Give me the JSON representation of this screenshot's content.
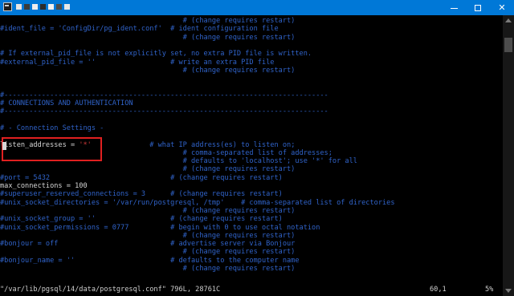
{
  "window": {
    "title_redacted_blocks": [
      "#e6e6e6",
      "#3b3b3b",
      "#ededed",
      "#2c2c2c",
      "#f0f0f0",
      "#4a4a4a",
      "#e8e8e8"
    ],
    "controls": {
      "minimize": "",
      "maximize": "",
      "close": "✕"
    }
  },
  "lines": [
    {
      "text": "                                            # (change requires restart)",
      "color": "blue"
    },
    {
      "text": "#ident_file = 'ConfigDir/pg_ident.conf'  # ident configuration file",
      "color": "blue"
    },
    {
      "text": "                                            # (change requires restart)",
      "color": "blue"
    },
    {
      "text": "",
      "color": "blue"
    },
    {
      "text": "# If external_pid_file is not explicitly set, no extra PID file is written.",
      "color": "blue"
    },
    {
      "text": "#external_pid_file = ''                  # write an extra PID file",
      "color": "blue"
    },
    {
      "text": "                                            # (change requires restart)",
      "color": "blue"
    },
    {
      "text": "",
      "color": "blue"
    },
    {
      "text": "",
      "color": "blue"
    },
    {
      "text": "#------------------------------------------------------------------------------",
      "color": "blue"
    },
    {
      "text": "# CONNECTIONS AND AUTHENTICATION",
      "color": "blue"
    },
    {
      "text": "#------------------------------------------------------------------------------",
      "color": "blue"
    },
    {
      "text": "",
      "color": "blue"
    },
    {
      "text": "# - Connection Settings -",
      "color": "blue"
    },
    {
      "text": "",
      "color": "blue"
    },
    {
      "text": "listen_addresses = '*'",
      "color": "white",
      "value_part": "'*'"
    },
    {
      "text": "                                            # comma-separated list of addresses;",
      "color": "blue"
    },
    {
      "text": "                                            # defaults to 'localhost'; use '*' for all",
      "color": "blue"
    },
    {
      "text": "                                            # (change requires restart)",
      "color": "blue"
    },
    {
      "text": "#port = 5432                             # (change requires restart)",
      "color": "blue"
    },
    {
      "text": "max_connections = 100",
      "color": "white"
    },
    {
      "text": "#superuser_reserved_connections = 3      # (change requires restart)",
      "color": "blue"
    },
    {
      "text": "#unix_socket_directories = '/var/run/postgresql, /tmp'    # comma-separated list of directories",
      "color": "blue"
    },
    {
      "text": "                                            # (change requires restart)",
      "color": "blue"
    },
    {
      "text": "#unix_socket_group = ''                  # (change requires restart)",
      "color": "blue"
    },
    {
      "text": "#unix_socket_permissions = 0777          # begin with 0 to use octal notation",
      "color": "blue"
    },
    {
      "text": "                                            # (change requires restart)",
      "color": "blue"
    },
    {
      "text": "#bonjour = off                           # advertise server via Bonjour",
      "color": "blue"
    },
    {
      "text": "                                            # (change requires restart)",
      "color": "blue"
    },
    {
      "text": "#bonjour_name = ''                       # defaults to the computer name",
      "color": "blue"
    },
    {
      "text": "                                            # (change requires restart)",
      "color": "blue"
    }
  ],
  "listen_line": {
    "key": "listen_addresses = ",
    "value": "'*'",
    "comment": "# what IP address(es) to listen on;"
  },
  "max_conn_comment": "                           # (change requires restart)",
  "status": {
    "file": "\"/var/lib/pgsql/14/data/postgresql.conf\" 796L, 28761C",
    "position": "60,1",
    "percent": "5%"
  },
  "scroll": {
    "position_fraction": 0.05
  },
  "colors": {
    "titlebar": "#0078d7",
    "comment": "#3063c9",
    "text": "#d6d6d6",
    "value": "#d23a3a",
    "highlight": "#e02020"
  }
}
